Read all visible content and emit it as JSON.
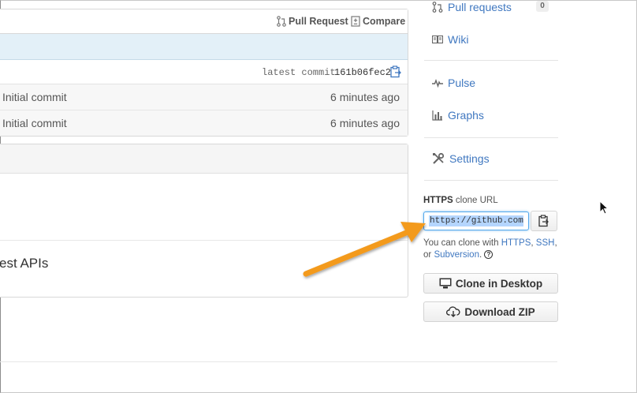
{
  "toolbar": {
    "pull_request_label": "Pull Request",
    "compare_label": "Compare"
  },
  "commit_bar": {
    "latest_commit_label": "latest commit",
    "commit_sha": "161b06fec2"
  },
  "files": [
    {
      "message": "Initial commit",
      "age": "6 minutes ago"
    },
    {
      "message": "Initial commit",
      "age": "6 minutes ago"
    }
  ],
  "readme": {
    "partial_text": "est APIs"
  },
  "sidebar": {
    "items": [
      {
        "label": "Pull requests",
        "icon": "pull-request-icon",
        "count": "0"
      },
      {
        "label": "Wiki",
        "icon": "book-icon"
      },
      {
        "label": "Pulse",
        "icon": "pulse-icon"
      },
      {
        "label": "Graphs",
        "icon": "graph-icon"
      },
      {
        "label": "Settings",
        "icon": "tools-icon"
      }
    ]
  },
  "clone": {
    "protocol": "HTTPS",
    "label_suffix": "clone URL",
    "url": "https://github.com/",
    "help_prefix": "You can clone with",
    "https_link": "HTTPS",
    "ssh_link": "SSH",
    "or_text": "or",
    "subversion_link": "Subversion"
  },
  "buttons": {
    "clone_desktop": "Clone in Desktop",
    "download_zip": "Download ZIP"
  },
  "colors": {
    "link": "#4078c0",
    "annotation_arrow": "#f39a1f",
    "selection": "#b4d5fe"
  }
}
